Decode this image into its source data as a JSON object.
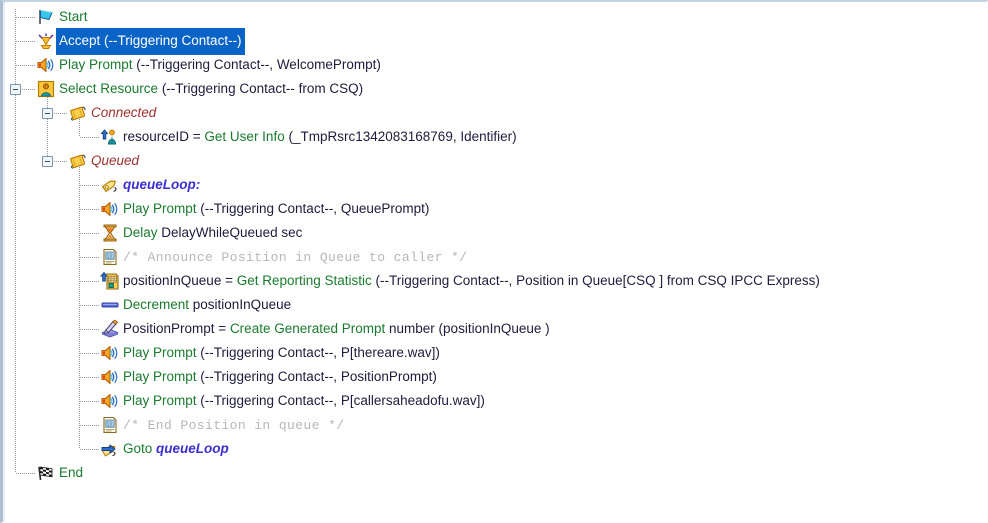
{
  "app": {
    "name": "script-editor-tree",
    "selected_row_index": 1,
    "colors": {
      "selection_blue": "#0a64c8",
      "keyword_green": "#1a7a30",
      "argument_navy": "#1c1c3c",
      "label_purple": "#3b2fd0",
      "branch_red": "#a03030",
      "comment_gray": "#b6b6bb",
      "tree_line_gray": "#8a9aab",
      "background": "#ffffff"
    }
  },
  "tree": {
    "rows": [
      {
        "id": "start",
        "depth": 0,
        "icon": "flag-start-icon",
        "expander": null,
        "selected": false,
        "type": "step",
        "keyword": "Start",
        "argument": ""
      },
      {
        "id": "accept",
        "depth": 0,
        "icon": "accept-contact-icon",
        "expander": null,
        "selected": true,
        "type": "step",
        "keyword": "Accept",
        "argument": " (--Triggering Contact--)"
      },
      {
        "id": "play-prompt-welcome",
        "depth": 0,
        "icon": "speaker-prompt-icon",
        "expander": null,
        "selected": false,
        "type": "step",
        "keyword": "Play Prompt",
        "argument": " (--Triggering Contact--, WelcomePrompt)"
      },
      {
        "id": "select-resource",
        "depth": 0,
        "icon": "person-resource-icon",
        "expander": "collapse",
        "selected": false,
        "type": "step",
        "keyword": "Select Resource",
        "argument": " (--Triggering Contact-- from CSQ)"
      },
      {
        "id": "branch-connected",
        "depth": 1,
        "icon": "branch-label-icon",
        "expander": "collapse",
        "selected": false,
        "type": "branch",
        "keyword": "Connected",
        "argument": ""
      },
      {
        "id": "get-user-info",
        "depth": 2,
        "icon": "get-user-info-icon",
        "expander": null,
        "selected": false,
        "type": "assign",
        "variable": "resourceID = ",
        "keyword": "Get User Info",
        "argument": " (_TmpRsrc1342083168769, Identifier)"
      },
      {
        "id": "branch-queued",
        "depth": 1,
        "icon": "branch-label-icon",
        "expander": "collapse",
        "selected": false,
        "type": "branch",
        "keyword": "Queued",
        "argument": ""
      },
      {
        "id": "label-queueloop",
        "depth": 2,
        "icon": "label-tag-icon",
        "expander": null,
        "selected": false,
        "type": "label",
        "keyword": "queueLoop:",
        "argument": ""
      },
      {
        "id": "play-prompt-queue",
        "depth": 2,
        "icon": "speaker-prompt-icon",
        "expander": null,
        "selected": false,
        "type": "step",
        "keyword": "Play Prompt",
        "argument": " (--Triggering Contact--, QueuePrompt)"
      },
      {
        "id": "delay",
        "depth": 2,
        "icon": "hourglass-delay-icon",
        "expander": null,
        "selected": false,
        "type": "step",
        "keyword": "Delay",
        "argument": " DelayWhileQueued sec"
      },
      {
        "id": "comment-announce",
        "depth": 2,
        "icon": "comment-note-icon",
        "expander": null,
        "selected": false,
        "type": "comment",
        "keyword": "/* Announce Position in Queue to caller */",
        "argument": ""
      },
      {
        "id": "get-reporting-statistic",
        "depth": 2,
        "icon": "get-reporting-statistic-icon",
        "expander": null,
        "selected": false,
        "type": "assign",
        "variable": "positionInQueue = ",
        "keyword": "Get Reporting Statistic",
        "argument": " (--Triggering Contact--, Position in Queue[CSQ ] from CSQ IPCC Express)"
      },
      {
        "id": "decrement",
        "depth": 2,
        "icon": "decrement-bar-icon",
        "expander": null,
        "selected": false,
        "type": "step",
        "keyword": "Decrement",
        "argument": " positionInQueue"
      },
      {
        "id": "create-generated-prompt",
        "depth": 2,
        "icon": "create-generated-prompt-icon",
        "expander": null,
        "selected": false,
        "type": "assign",
        "variable": "PositionPrompt = ",
        "keyword": "Create Generated Prompt",
        "argument": " number (positionInQueue )"
      },
      {
        "id": "play-prompt-thereare",
        "depth": 2,
        "icon": "speaker-prompt-icon",
        "expander": null,
        "selected": false,
        "type": "step",
        "keyword": "Play Prompt",
        "argument": " (--Triggering Contact--, P[thereare.wav])"
      },
      {
        "id": "play-prompt-position",
        "depth": 2,
        "icon": "speaker-prompt-icon",
        "expander": null,
        "selected": false,
        "type": "step",
        "keyword": "Play Prompt",
        "argument": " (--Triggering Contact--, PositionPrompt)"
      },
      {
        "id": "play-prompt-callersahead",
        "depth": 2,
        "icon": "speaker-prompt-icon",
        "expander": null,
        "selected": false,
        "type": "step",
        "keyword": "Play Prompt",
        "argument": " (--Triggering Contact--, P[callersaheadofu.wav])"
      },
      {
        "id": "comment-end-position",
        "depth": 2,
        "icon": "comment-note-icon",
        "expander": null,
        "selected": false,
        "type": "comment",
        "keyword": "/* End Position in queue */",
        "argument": ""
      },
      {
        "id": "goto-queueloop",
        "depth": 2,
        "icon": "goto-arrow-icon",
        "expander": null,
        "selected": false,
        "type": "goto",
        "keyword": "Goto ",
        "argument": "queueLoop"
      },
      {
        "id": "end",
        "depth": 0,
        "icon": "checkered-flag-end-icon",
        "expander": null,
        "selected": false,
        "type": "step",
        "keyword": "End",
        "argument": ""
      }
    ]
  }
}
